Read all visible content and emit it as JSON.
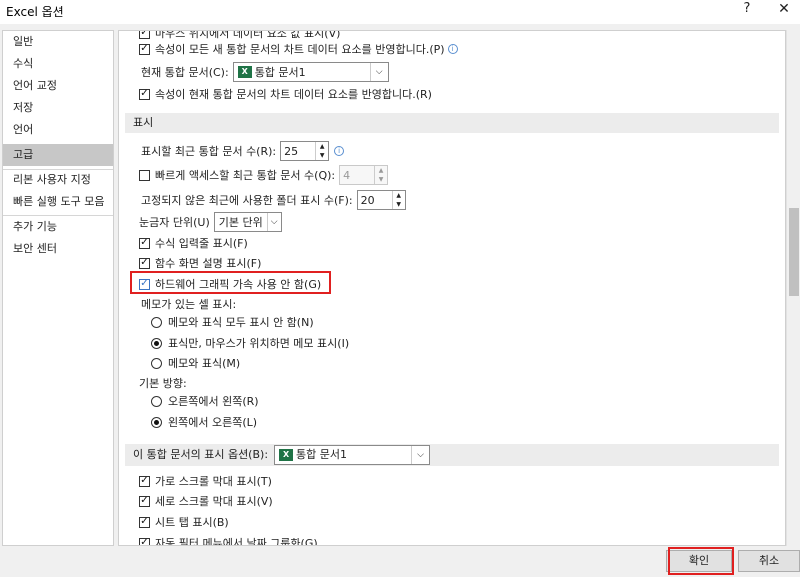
{
  "window": {
    "title": "Excel 옵션",
    "help": "?",
    "close": "✕"
  },
  "sidebar": {
    "items": [
      {
        "label": "일반"
      },
      {
        "label": "수식"
      },
      {
        "label": "언어 교정"
      },
      {
        "label": "저장"
      },
      {
        "label": "언어"
      },
      {
        "label": "고급",
        "active": true
      },
      {
        "label": "리본 사용자 지정"
      },
      {
        "label": "빠른 실행 도구 모음"
      },
      {
        "label": "추가 기능"
      },
      {
        "label": "보안 센터"
      }
    ]
  },
  "chart_section": {
    "top_cut_label": "마우스 위치에서 데이터 요소 값 표시(V)",
    "all_new_label": "속성이 모든 새 통합 문서의 차트 데이터 요소를 반영합니다.(P)",
    "current_wb_label": "현재 통합 문서(C):",
    "current_wb_value": "통합 문서1",
    "current_props_label": "속성이 현재 통합 문서의 차트 데이터 요소를 반영합니다.(R)"
  },
  "display_section": {
    "header": "표시",
    "recent_count_label": "표시할 최근 통합 문서 수(R):",
    "recent_count_value": "25",
    "quick_access_label": "빠르게 액세스할 최근 통합 문서 수(Q):",
    "quick_access_value": "4",
    "unpinned_label": "고정되지 않은 최근에 사용한 폴더 표시 수(F):",
    "unpinned_value": "20",
    "ruler_label": "눈금자 단위(U)",
    "ruler_value": "기본 단위",
    "formula_bar_label": "수식 입력줄 표시(F)",
    "function_tip_label": "함수 화면 설명 표시(F)",
    "hw_accel_label": "하드웨어 그래픽 가속 사용 안 함(G)",
    "comments_header": "메모가 있는 셀 표시:",
    "comment_opt1": "메모와 표식 모두 표시 안 함(N)",
    "comment_opt2": "표식만, 마우스가 위치하면 메모 표시(I)",
    "comment_opt3": "메모와 표식(M)",
    "direction_header": "기본 방향:",
    "dir_opt1": "오른쪽에서 왼쪽(R)",
    "dir_opt2": "왼쪽에서 오른쪽(L)"
  },
  "workbook_section": {
    "header": "이 통합 문서의 표시 옵션(B):",
    "workbook_value": "통합 문서1",
    "hscroll_label": "가로 스크롤 막대 표시(T)",
    "vscroll_label": "세로 스크롤 막대 표시(V)",
    "sheet_tabs_label": "시트 탭 표시(B)",
    "autofilter_label": "자동 필터 메뉴에서 날짜 그룹화(G)"
  },
  "footer": {
    "ok_label": "확인",
    "cancel_label": "취소"
  },
  "icons": {
    "excel_icon": "excel-workbook-icon",
    "info_icon": "info-icon"
  },
  "colors": {
    "highlight": "#e02020",
    "excel_green": "#1f7346",
    "sidebar_active": "#c7c7c7",
    "section_header": "#ececec"
  }
}
